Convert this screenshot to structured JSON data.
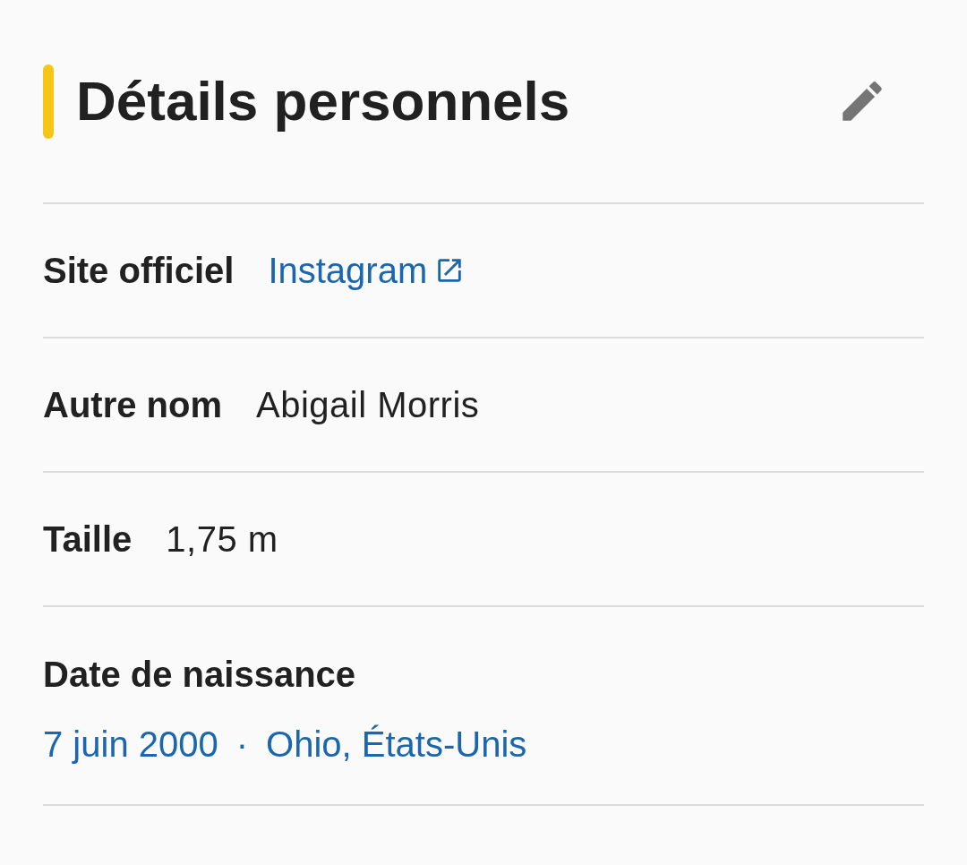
{
  "header": {
    "title": "Détails personnels",
    "editable": true
  },
  "rows": [
    {
      "kind": "inline",
      "label": "Site officiel",
      "values": [
        {
          "text": "Instagram",
          "link": true,
          "external": true
        }
      ]
    },
    {
      "kind": "inline",
      "label": "Autre nom",
      "values": [
        {
          "text": "Abigail Morris",
          "link": false,
          "external": false
        }
      ]
    },
    {
      "kind": "inline",
      "label": "Taille",
      "values": [
        {
          "text": "1,75 m",
          "link": false,
          "external": false
        }
      ]
    },
    {
      "kind": "stacked",
      "label": "Date de naissance",
      "separator": "·",
      "values": [
        {
          "text": "7 juin 2000",
          "link": true,
          "external": false
        },
        {
          "text": "Ohio, États-Unis",
          "link": true,
          "external": false
        }
      ]
    }
  ]
}
